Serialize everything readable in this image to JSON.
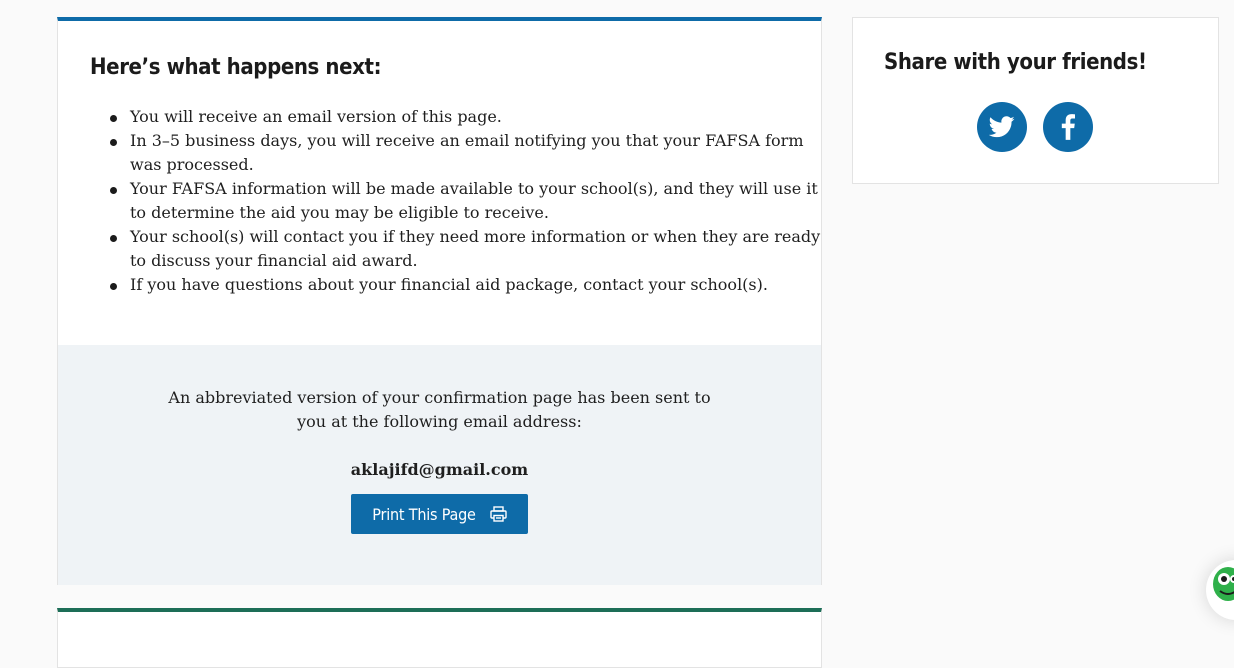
{
  "next_steps": {
    "heading": "Here’s what happens next:",
    "items": [
      "You will receive an email version of this page.",
      "In 3–5 business days, you will receive an email notifying you that your FAFSA form was processed.",
      "Your FAFSA information will be made available to your school(s), and they will use it to determine the aid you may be eligible to receive.",
      "Your school(s) will contact you if they need more information or when they are ready to discuss your financial aid award.",
      "If you have questions about your financial aid package, contact your school(s)."
    ]
  },
  "email_panel": {
    "note": "An abbreviated version of your confirmation page has been sent to you at the following email address:",
    "email": "aklajifd@gmail.com",
    "print_label": "Print This Page",
    "print_icon": "printer-icon"
  },
  "share": {
    "heading": "Share with your friends!",
    "icons": [
      "twitter-icon",
      "facebook-icon"
    ]
  },
  "colors": {
    "primary_blue": "#0e6ba8",
    "panel_bg": "#eff3f6",
    "green_accent": "#1d6e57"
  }
}
